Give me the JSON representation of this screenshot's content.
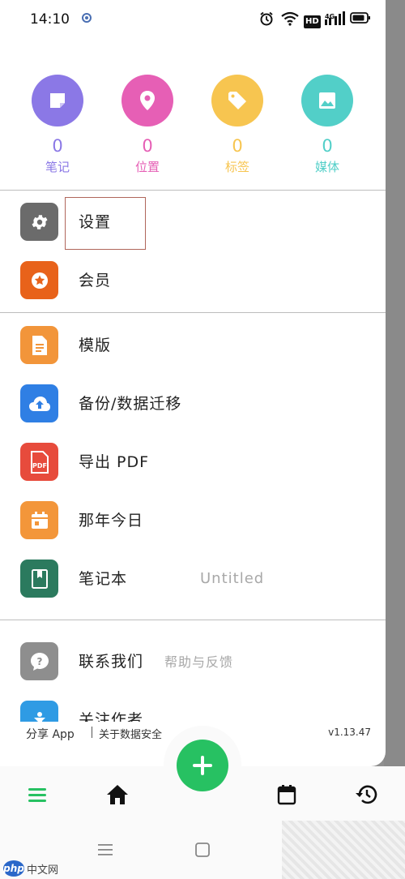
{
  "status_bar": {
    "time": "14:10",
    "icons": [
      "app-notification-icon",
      "alarm-icon",
      "wifi-icon",
      "hd-icon",
      "signal-4g-icon",
      "battery-icon"
    ],
    "hd_label": "HD",
    "network_label": "4G"
  },
  "stats": [
    {
      "count": "0",
      "label": "笔记",
      "color": "#8b78e6",
      "icon": "note-icon"
    },
    {
      "count": "0",
      "label": "位置",
      "color": "#e65fb5",
      "icon": "location-pin-icon"
    },
    {
      "count": "0",
      "label": "标签",
      "color": "#f7c550",
      "icon": "tag-icon"
    },
    {
      "count": "0",
      "label": "媒体",
      "color": "#52cfc8",
      "icon": "image-icon"
    }
  ],
  "menu_group1": [
    {
      "label": "设置",
      "icon": "gear-icon",
      "color": "#6b6b6b"
    },
    {
      "label": "会员",
      "icon": "star-badge-icon",
      "color": "#e8621a"
    }
  ],
  "menu_group2": [
    {
      "label": "模版",
      "icon": "document-icon",
      "color": "#f2953a"
    },
    {
      "label": "备份/数据迁移",
      "icon": "cloud-upload-icon",
      "color": "#2f7fe4"
    },
    {
      "label": "导出 PDF",
      "icon": "pdf-icon",
      "color": "#e74b3c",
      "icon_text": "PDF"
    },
    {
      "label": "那年今日",
      "icon": "calendar-icon",
      "color": "#f3963a"
    },
    {
      "label": "笔记本",
      "icon": "notebook-icon",
      "color": "#2b7a5e",
      "value": "Untitled"
    }
  ],
  "menu_group3": [
    {
      "label": "联系我们",
      "icon": "help-bubble-icon",
      "color": "#8e8e8e",
      "value": "帮助与反馈"
    },
    {
      "label": "关注作者",
      "icon": "person-icon",
      "color": "#2f9be4"
    }
  ],
  "footer": {
    "share": "分享 App",
    "about": "关于数据安全",
    "version": "v1.13.47"
  },
  "bottom_nav": {
    "items": [
      "menu-icon",
      "home-icon",
      "calendar-icon",
      "history-icon"
    ],
    "accent": "#27c162"
  },
  "watermark": {
    "logo": "php",
    "text": "中文网"
  }
}
